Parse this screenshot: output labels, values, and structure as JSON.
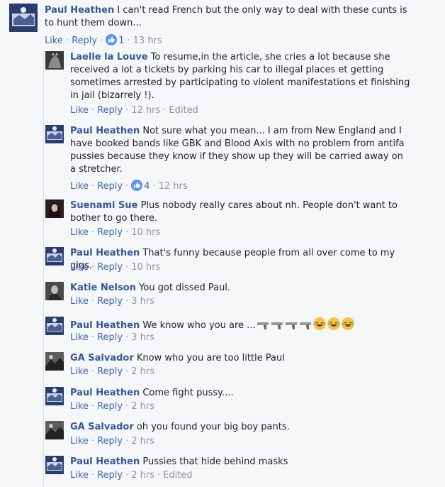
{
  "comments": [
    {
      "author": "Paul Heathen",
      "text": "I can't read French but the only way to deal with these cunts is to hunt them down...",
      "like": "Like",
      "reply": "Reply",
      "reactions": "1",
      "time": "13 hrs",
      "edited": ""
    },
    {
      "author": "Laelle la Louve",
      "text": "To resume,in the article, she cries a lot because she received a lot a tickets by parking his car to illegal places et getting sometimes arrested by participating to violent manifestations et finishing in jail (bizarrely !).",
      "like": "Like",
      "reply": "Reply",
      "reactions": "",
      "time": "12 hrs",
      "edited": "Edited"
    },
    {
      "author": "Paul Heathen",
      "text": "Not sure what you mean... I am from New England and I have booked bands like GBK and Blood Axis with no problem from antifa pussies because they know if they show up they will be carried away on a stretcher.",
      "like": "Like",
      "reply": "Reply",
      "reactions": "4",
      "time": "12 hrs",
      "edited": ""
    },
    {
      "author": "Suenami Sue",
      "text": "Plus nobody really cares about nh. People don't want to bother to go there.",
      "like": "Like",
      "reply": "Reply",
      "reactions": "",
      "time": "10 hrs",
      "edited": ""
    },
    {
      "author": "Paul Heathen",
      "text": "That's funny because people from all over come to my gigs.",
      "like": "Like",
      "reply": "Reply",
      "reactions": "",
      "time": "10 hrs",
      "edited": ""
    },
    {
      "author": "Katie Nelson",
      "text": "You got dissed Paul.",
      "like": "Like",
      "reply": "Reply",
      "reactions": "",
      "time": "3 hrs",
      "edited": ""
    },
    {
      "author": "Paul Heathen",
      "text": "We know who you are ...",
      "like": "Like",
      "reply": "Reply",
      "reactions": "",
      "time": "3 hrs",
      "edited": ""
    },
    {
      "author": "GA Salvador",
      "text": "Know who you are too little Paul",
      "like": "Like",
      "reply": "Reply",
      "reactions": "",
      "time": "2 hrs",
      "edited": ""
    },
    {
      "author": "Paul Heathen",
      "text": "Come fight pussy....",
      "like": "Like",
      "reply": "Reply",
      "reactions": "",
      "time": "2 hrs",
      "edited": ""
    },
    {
      "author": "GA Salvador",
      "text": "oh you found your big boy pants.",
      "like": "Like",
      "reply": "Reply",
      "reactions": "",
      "time": "2 hrs",
      "edited": ""
    },
    {
      "author": "Paul Heathen",
      "text": "Pussies that hide behind masks",
      "like": "Like",
      "reply": "Reply",
      "reactions": "",
      "time": "2 hrs",
      "edited": "Edited"
    }
  ],
  "colors": {
    "name": "#365899",
    "link": "#4267b2",
    "meta": "#90949c",
    "background": "#f6f7f9"
  },
  "icons": {
    "like_badge": "thumbs-up-icon",
    "gun_emoji": "pistol-emoji-icon",
    "laugh_emoji": "laughing-emoji-icon"
  }
}
